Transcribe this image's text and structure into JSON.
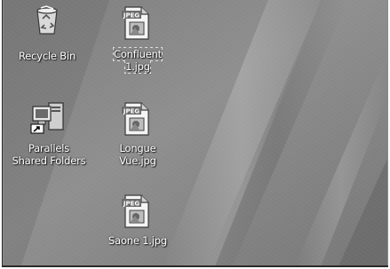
{
  "desktop": {
    "icons": [
      {
        "name": "recycle-bin-icon",
        "label": "Recycle Bin",
        "selected": false
      },
      {
        "name": "parallels-shared-folders-icon",
        "label": "Parallels\nShared Folders",
        "selected": false
      },
      {
        "name": "jpeg-file-icon",
        "label": "Confluent\n1.jpg",
        "badge": "JPEG",
        "selected": true
      },
      {
        "name": "jpeg-file-icon",
        "label": "Longue\nVue.jpg",
        "badge": "JPEG",
        "selected": false
      },
      {
        "name": "jpeg-file-icon",
        "label": "Saone 1.jpg",
        "badge": "JPEG",
        "selected": false
      }
    ]
  },
  "colors": {
    "wallpaper_light": "#a3a3a3",
    "wallpaper_dark": "#6e6e6e",
    "label_text": "#ffffff"
  }
}
